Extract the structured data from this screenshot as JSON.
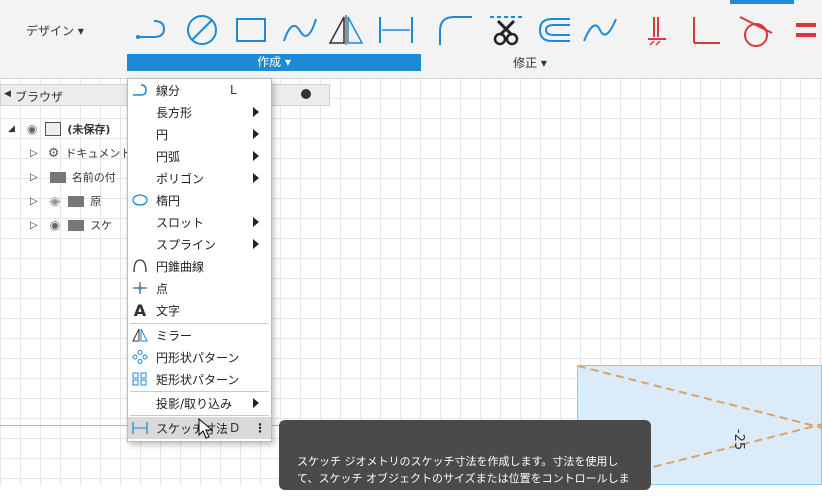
{
  "ribbon": {
    "design_label": "デザイン ▾",
    "create_label": "作成 ▾",
    "modify_label": "修正 ▾",
    "tools": [
      "line-tool-icon",
      "circle-tool-icon",
      "rectangle-tool-icon",
      "spline-tool-icon",
      "mirror-tool-icon",
      "dimension-tool-icon",
      "fillet-tool-icon",
      "trim-tool-icon",
      "offset-tool-icon",
      "curve-tool-icon",
      "hatch-icon",
      "perpendicular-icon",
      "tangent-icon",
      "equal-icon"
    ]
  },
  "browser": {
    "title": "ブラウザ",
    "rows": [
      {
        "label": "(未保存)"
      },
      {
        "label": "ドキュメント"
      },
      {
        "label": "名前の付"
      },
      {
        "label": "原"
      },
      {
        "label": "スケ"
      }
    ]
  },
  "menu": {
    "items": [
      {
        "label": "線分",
        "shortcut": "L",
        "icon": "line-icon"
      },
      {
        "label": "長方形",
        "submenu": true
      },
      {
        "label": "円",
        "submenu": true
      },
      {
        "label": "円弧",
        "submenu": true
      },
      {
        "label": "ポリゴン",
        "submenu": true
      },
      {
        "label": "楕円",
        "icon": "ellipse-icon"
      },
      {
        "label": "スロット",
        "submenu": true
      },
      {
        "label": "スプライン",
        "submenu": true
      },
      {
        "label": "円錐曲線",
        "icon": "conic-icon"
      },
      {
        "label": "点",
        "icon": "point-icon"
      },
      {
        "label": "文字",
        "icon": "text-icon"
      },
      {
        "label": "ミラー",
        "icon": "mirror-icon"
      },
      {
        "label": "円形状パターン",
        "icon": "circular-pattern-icon"
      },
      {
        "label": "矩形状パターン",
        "icon": "rectangular-pattern-icon"
      },
      {
        "label": "投影/取り込み",
        "submenu": true
      },
      {
        "label": "スケッチ寸法",
        "shortcut": "D",
        "icon": "dimension-icon"
      }
    ]
  },
  "tooltip": {
    "line1": "スケッチ ジオメトリのスケッチ寸法を作成します。寸法を使用し",
    "line2": "て、スケッチ オブジェクトのサイズまたは位置をコントロールします。"
  },
  "canvas": {
    "dimension_value": "-25"
  },
  "colors": {
    "accent": "#1e8ad6",
    "sketch_fill": "#dcebfa",
    "constraint_red": "#d9373a"
  }
}
